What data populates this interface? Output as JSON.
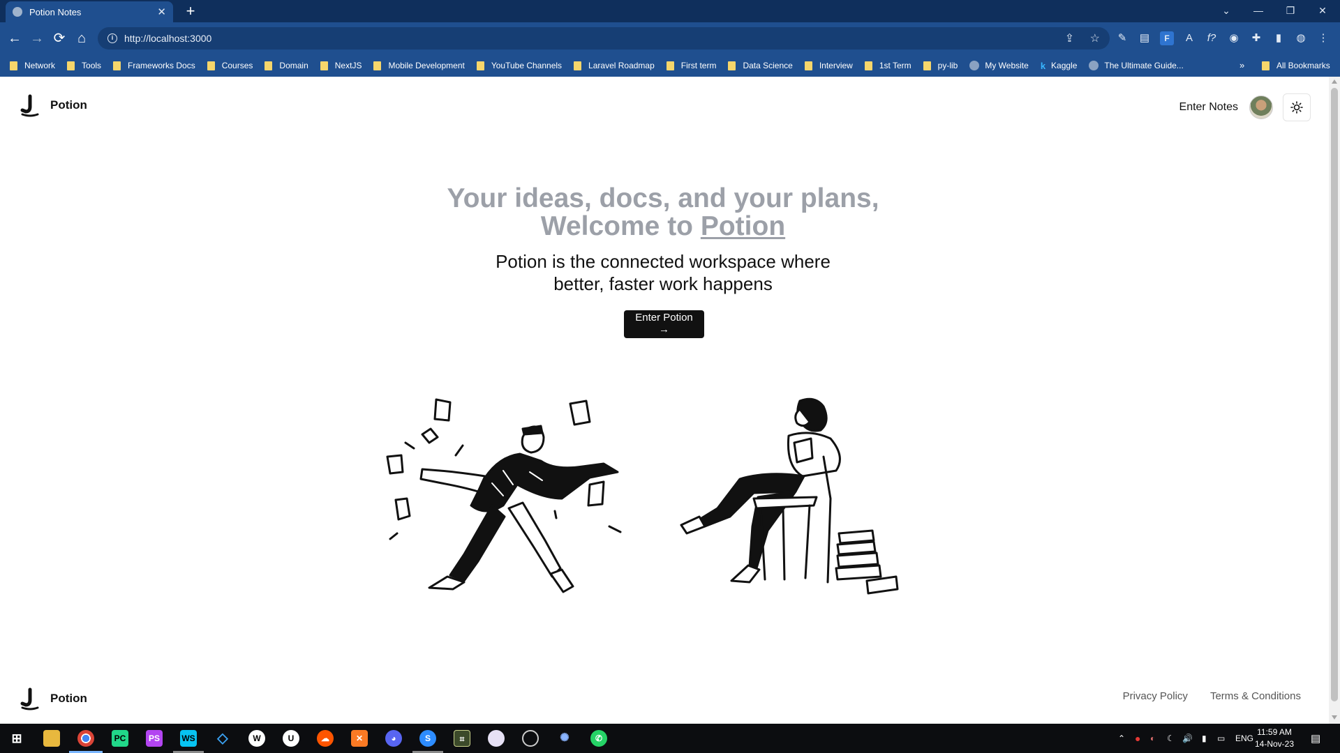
{
  "browser": {
    "tab_title": "Potion Notes",
    "url": "http://localhost:3000",
    "bookmarks": [
      {
        "label": "Network",
        "icon": "folder"
      },
      {
        "label": "Tools",
        "icon": "folder"
      },
      {
        "label": "Frameworks Docs",
        "icon": "folder"
      },
      {
        "label": "Courses",
        "icon": "folder"
      },
      {
        "label": "Domain",
        "icon": "folder"
      },
      {
        "label": "NextJS",
        "icon": "folder"
      },
      {
        "label": "Mobile Development",
        "icon": "folder"
      },
      {
        "label": "YouTube Channels",
        "icon": "folder"
      },
      {
        "label": "Laravel Roadmap",
        "icon": "folder"
      },
      {
        "label": "First term",
        "icon": "folder"
      },
      {
        "label": "Data Science",
        "icon": "folder"
      },
      {
        "label": "Interview",
        "icon": "folder"
      },
      {
        "label": "1st Term",
        "icon": "folder"
      },
      {
        "label": "py-lib",
        "icon": "folder"
      },
      {
        "label": "My Website",
        "icon": "site"
      },
      {
        "label": "Kaggle",
        "icon": "kaggle"
      },
      {
        "label": "The Ultimate Guide...",
        "icon": "site"
      }
    ],
    "bookmarks_more": "»",
    "all_bookmarks": "All Bookmarks"
  },
  "page": {
    "brand": "Potion",
    "nav_enter_notes": "Enter Notes",
    "hero_title_main": "Your ideas, docs, and your plans, Welcome to ",
    "hero_title_brand": "Potion",
    "hero_subtitle_line1": "Potion is the connected workspace where",
    "hero_subtitle_line2": "better, faster work happens",
    "cta_label": "Enter Potion",
    "cta_arrow": "→",
    "footer_brand": "Potion",
    "footer_links": [
      "Privacy Policy",
      "Terms & Conditions"
    ]
  },
  "taskbar": {
    "language": "ENG",
    "time": "11:59 AM",
    "date": "14-Nov-23"
  }
}
